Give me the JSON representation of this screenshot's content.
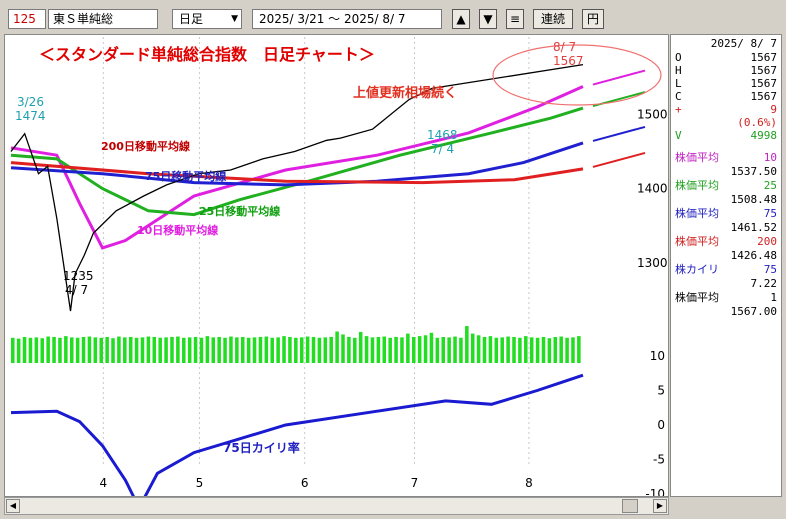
{
  "toolbar": {
    "code": "125",
    "name": "東Ｓ単純総",
    "period": "日足",
    "date_range": "2025/ 3/21 ～  2025/ 8/ 7",
    "btn_up": "▲",
    "btn_down": "▼",
    "btn_menu": "≡",
    "btn_renzoku": "連続",
    "btn_yen": "円"
  },
  "chart_data": {
    "type": "line",
    "title": "＜スタンダード単純総合指数　日足チャート＞",
    "annotation_trend": "上値更新相場続く",
    "price_axis": {
      "ticks": [
        1300,
        1400,
        1500
      ],
      "ylim": [
        1200,
        1580
      ]
    },
    "kairi_axis": {
      "ticks": [
        10,
        5,
        0,
        -5,
        -10
      ],
      "ylim": [
        -14,
        12
      ]
    },
    "x_month_labels": [
      "4",
      "5",
      "6",
      "7",
      "8"
    ],
    "price": [
      {
        "date": "3/21",
        "v": 1450
      },
      {
        "date": "3/26",
        "v": 1474
      },
      {
        "date": "3/31",
        "v": 1420
      },
      {
        "date": "4/2",
        "v": 1430
      },
      {
        "date": "4/4",
        "v": 1360
      },
      {
        "date": "4/7",
        "v": 1235
      },
      {
        "date": "4/8",
        "v": 1285
      },
      {
        "date": "4/10",
        "v": 1310
      },
      {
        "date": "4/14",
        "v": 1340
      },
      {
        "date": "4/21",
        "v": 1370
      },
      {
        "date": "4/30",
        "v": 1390
      },
      {
        "date": "5/9",
        "v": 1405
      },
      {
        "date": "5/20",
        "v": 1420
      },
      {
        "date": "5/30",
        "v": 1425
      },
      {
        "date": "6/10",
        "v": 1440
      },
      {
        "date": "6/20",
        "v": 1450
      },
      {
        "date": "6/30",
        "v": 1465
      },
      {
        "date": "7/4",
        "v": 1468
      },
      {
        "date": "7/15",
        "v": 1480
      },
      {
        "date": "7/25",
        "v": 1520
      },
      {
        "date": "8/1",
        "v": 1535
      },
      {
        "date": "8/7",
        "v": 1567
      }
    ],
    "ma_series": [
      {
        "name": "10日移動平均線",
        "color": "#e020e0",
        "points": [
          [
            0,
            1455
          ],
          [
            10,
            1445
          ],
          [
            15,
            1380
          ],
          [
            20,
            1320
          ],
          [
            25,
            1330
          ],
          [
            40,
            1390
          ],
          [
            60,
            1425
          ],
          [
            80,
            1445
          ],
          [
            100,
            1475
          ],
          [
            115,
            1510
          ],
          [
            125,
            1537.5
          ]
        ]
      },
      {
        "name": "25日移動平均線",
        "color": "#20b020",
        "points": [
          [
            0,
            1445
          ],
          [
            10,
            1440
          ],
          [
            20,
            1400
          ],
          [
            30,
            1370
          ],
          [
            40,
            1365
          ],
          [
            50,
            1385
          ],
          [
            65,
            1410
          ],
          [
            85,
            1445
          ],
          [
            105,
            1475
          ],
          [
            118,
            1495
          ],
          [
            125,
            1508.48
          ]
        ]
      },
      {
        "name": "75日移動平均線",
        "color": "#2020d0",
        "points": [
          [
            0,
            1428
          ],
          [
            20,
            1420
          ],
          [
            40,
            1408
          ],
          [
            60,
            1405
          ],
          [
            80,
            1410
          ],
          [
            100,
            1420
          ],
          [
            112,
            1435
          ],
          [
            125,
            1461.52
          ]
        ]
      },
      {
        "name": "200日移動平均線",
        "color": "#e02020",
        "points": [
          [
            0,
            1435
          ],
          [
            30,
            1420
          ],
          [
            60,
            1410
          ],
          [
            90,
            1408
          ],
          [
            110,
            1412
          ],
          [
            125,
            1426.48
          ]
        ]
      }
    ],
    "volume": [
      60,
      58,
      62,
      60,
      61,
      59,
      63,
      62,
      60,
      64,
      61,
      60,
      62,
      63,
      61,
      60,
      62,
      59,
      63,
      61,
      62,
      60,
      61,
      63,
      62,
      60,
      61,
      62,
      63,
      60,
      61,
      62,
      60,
      64,
      61,
      62,
      60,
      63,
      61,
      62,
      60,
      61,
      62,
      63,
      60,
      61,
      64,
      62,
      60,
      61,
      63,
      62,
      60,
      61,
      62,
      75,
      68,
      62,
      60,
      74,
      64,
      61,
      62,
      63,
      60,
      62,
      61,
      70,
      62,
      64,
      66,
      72,
      60,
      62,
      61,
      63,
      60,
      88,
      70,
      66,
      62,
      64,
      60,
      61,
      63,
      62,
      60,
      64,
      61,
      60,
      62,
      59,
      62,
      63,
      60,
      61,
      64
    ],
    "kairi": [
      [
        0,
        1.8
      ],
      [
        10,
        2.0
      ],
      [
        15,
        0.5
      ],
      [
        20,
        -3
      ],
      [
        25,
        -8
      ],
      [
        28,
        -12
      ],
      [
        32,
        -7
      ],
      [
        40,
        -4
      ],
      [
        60,
        0
      ],
      [
        80,
        2
      ],
      [
        95,
        3.5
      ],
      [
        105,
        3
      ],
      [
        115,
        5
      ],
      [
        125,
        7.22
      ]
    ],
    "labels": {
      "ma200": "200日移動平均線",
      "ma75": "75日移動平均線",
      "ma25": "25日移動平均線",
      "ma10": "10日移動平均線",
      "kairi": "75日カイリ率",
      "start_date": "3/26",
      "start_val": "1474",
      "low_val": "1235",
      "low_date": "4/ 7",
      "mid_val": "1468",
      "mid_date": "7/ 4",
      "end_date": "8/ 7",
      "end_val": "1567"
    }
  },
  "panel": {
    "date": "2025/ 8/ 7",
    "ohlc": [
      {
        "k": "O",
        "v": "1567"
      },
      {
        "k": "H",
        "v": "1567"
      },
      {
        "k": "L",
        "v": "1567"
      },
      {
        "k": "C",
        "v": "1567"
      },
      {
        "k": "+",
        "v": "9"
      },
      {
        "k": "",
        "v": "(0.6%)"
      },
      {
        "k": "V",
        "v": "4998"
      }
    ],
    "indicators": [
      {
        "label": "株価平均",
        "param": "10",
        "value": "1537.50",
        "color": "#c020c0"
      },
      {
        "label": "株価平均",
        "param": "25",
        "value": "1508.48",
        "color": "#20a020"
      },
      {
        "label": "株価平均",
        "param": "75",
        "value": "1461.52",
        "color": "#2020c0"
      },
      {
        "label": "株価平均",
        "param": "200",
        "value": "1426.48",
        "color": "#d02020"
      },
      {
        "label": "株カイリ",
        "param": "75",
        "value": "7.22",
        "color": "#2020c0"
      },
      {
        "label": "株価平均",
        "param": "1",
        "value": "1567.00",
        "color": "#000000"
      }
    ]
  }
}
